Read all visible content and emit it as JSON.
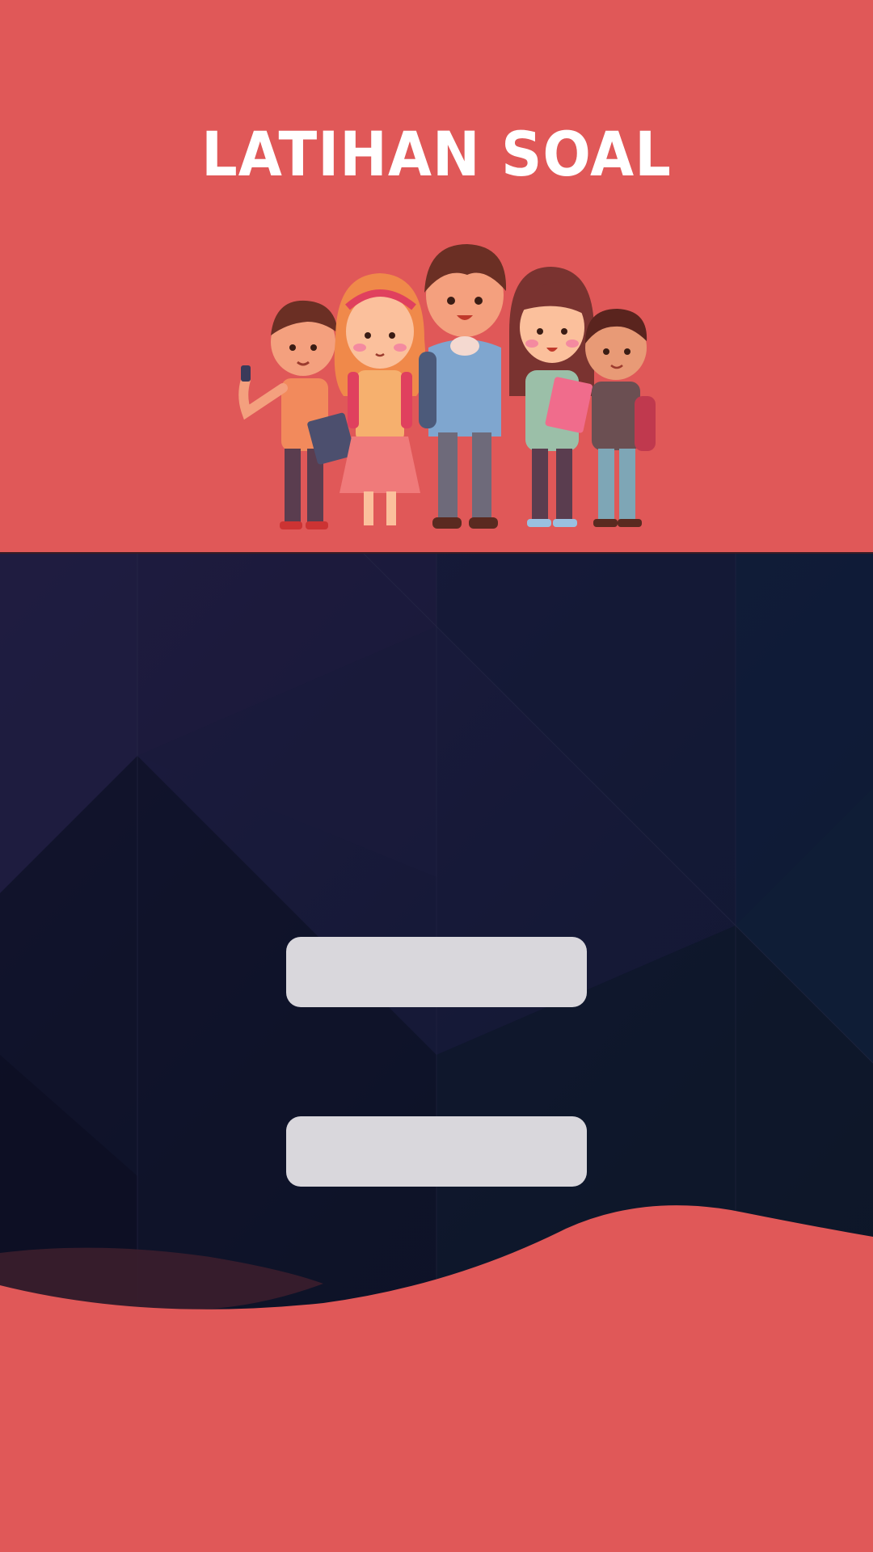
{
  "header": {
    "title": "LATIHAN SOAL",
    "background_color": "#e05858",
    "illustration": "group-of-students-illustration"
  },
  "main": {
    "background_color": "#131a33",
    "buttons": [
      {
        "label": ""
      },
      {
        "label": ""
      }
    ],
    "button_color": "#d9d7dc"
  },
  "footer": {
    "wave_color": "#e05858"
  }
}
